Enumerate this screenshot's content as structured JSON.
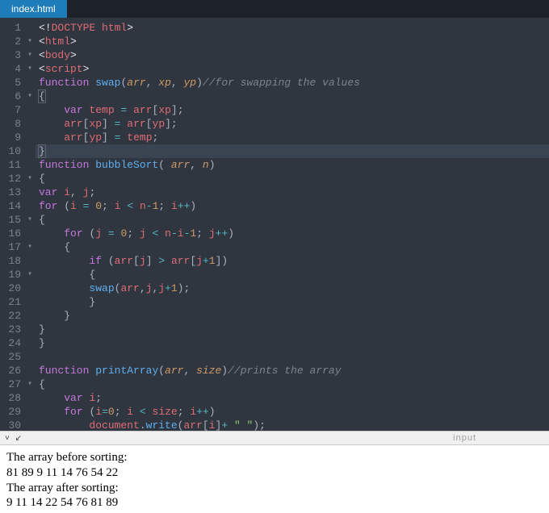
{
  "tab": {
    "label": "index.html"
  },
  "divider": {
    "left_icons": "˅   ↙",
    "right_label": "input"
  },
  "editor": {
    "lines": [
      {
        "n": 1,
        "fold": " ",
        "tokens": [
          [
            "tag-punc",
            "<!"
          ],
          [
            "tag-name",
            "DOCTYPE"
          ],
          [
            "plain",
            " "
          ],
          [
            "ident",
            "html"
          ],
          [
            "tag-punc",
            ">"
          ]
        ]
      },
      {
        "n": 2,
        "fold": "▾",
        "tokens": [
          [
            "tag-punc",
            "<"
          ],
          [
            "tag-name",
            "html"
          ],
          [
            "tag-punc",
            ">"
          ]
        ]
      },
      {
        "n": 3,
        "fold": "▾",
        "tokens": [
          [
            "tag-punc",
            "<"
          ],
          [
            "tag-name",
            "body"
          ],
          [
            "tag-punc",
            ">"
          ]
        ]
      },
      {
        "n": 4,
        "fold": "▾",
        "tokens": [
          [
            "tag-punc",
            "<"
          ],
          [
            "tag-name",
            "script"
          ],
          [
            "tag-punc",
            ">"
          ]
        ]
      },
      {
        "n": 5,
        "fold": " ",
        "tokens": [
          [
            "kw",
            "function"
          ],
          [
            "plain",
            " "
          ],
          [
            "fn",
            "swap"
          ],
          [
            "punc",
            "("
          ],
          [
            "param",
            "arr"
          ],
          [
            "punc",
            ", "
          ],
          [
            "param",
            "xp"
          ],
          [
            "punc",
            ", "
          ],
          [
            "param",
            "yp"
          ],
          [
            "punc",
            ")"
          ],
          [
            "cmt",
            "//for swapping the values"
          ]
        ]
      },
      {
        "n": 6,
        "fold": "▾",
        "tokens": [
          [
            "punc",
            "{",
            "brace-hl"
          ]
        ]
      },
      {
        "n": 7,
        "fold": " ",
        "tokens": [
          [
            "plain",
            "    "
          ],
          [
            "kw",
            "var"
          ],
          [
            "plain",
            " "
          ],
          [
            "ident",
            "temp"
          ],
          [
            "plain",
            " "
          ],
          [
            "op",
            "="
          ],
          [
            "plain",
            " "
          ],
          [
            "ident",
            "arr"
          ],
          [
            "punc",
            "["
          ],
          [
            "ident",
            "xp"
          ],
          [
            "punc",
            "];"
          ]
        ]
      },
      {
        "n": 8,
        "fold": " ",
        "tokens": [
          [
            "plain",
            "    "
          ],
          [
            "ident",
            "arr"
          ],
          [
            "punc",
            "["
          ],
          [
            "ident",
            "xp"
          ],
          [
            "punc",
            "]"
          ],
          [
            "plain",
            " "
          ],
          [
            "op",
            "="
          ],
          [
            "plain",
            " "
          ],
          [
            "ident",
            "arr"
          ],
          [
            "punc",
            "["
          ],
          [
            "ident",
            "yp"
          ],
          [
            "punc",
            "];"
          ]
        ]
      },
      {
        "n": 9,
        "fold": " ",
        "tokens": [
          [
            "plain",
            "    "
          ],
          [
            "ident",
            "arr"
          ],
          [
            "punc",
            "["
          ],
          [
            "ident",
            "yp"
          ],
          [
            "punc",
            "]"
          ],
          [
            "plain",
            " "
          ],
          [
            "op",
            "="
          ],
          [
            "plain",
            " "
          ],
          [
            "ident",
            "temp"
          ],
          [
            "punc",
            ";"
          ]
        ]
      },
      {
        "n": 10,
        "fold": " ",
        "highlight": true,
        "tokens": [
          [
            "punc",
            "}",
            "brace-hl"
          ]
        ]
      },
      {
        "n": 11,
        "fold": " ",
        "tokens": [
          [
            "kw",
            "function"
          ],
          [
            "plain",
            " "
          ],
          [
            "fn",
            "bubbleSort"
          ],
          [
            "punc",
            "( "
          ],
          [
            "param",
            "arr"
          ],
          [
            "punc",
            ", "
          ],
          [
            "param",
            "n"
          ],
          [
            "punc",
            ")"
          ]
        ]
      },
      {
        "n": 12,
        "fold": "▾",
        "tokens": [
          [
            "punc",
            "{"
          ]
        ]
      },
      {
        "n": 13,
        "fold": " ",
        "tokens": [
          [
            "kw",
            "var"
          ],
          [
            "plain",
            " "
          ],
          [
            "ident",
            "i"
          ],
          [
            "punc",
            ", "
          ],
          [
            "ident",
            "j"
          ],
          [
            "punc",
            ";"
          ]
        ]
      },
      {
        "n": 14,
        "fold": " ",
        "tokens": [
          [
            "kw",
            "for"
          ],
          [
            "plain",
            " "
          ],
          [
            "punc",
            "("
          ],
          [
            "ident",
            "i"
          ],
          [
            "plain",
            " "
          ],
          [
            "op",
            "="
          ],
          [
            "plain",
            " "
          ],
          [
            "num",
            "0"
          ],
          [
            "punc",
            "; "
          ],
          [
            "ident",
            "i"
          ],
          [
            "plain",
            " "
          ],
          [
            "op",
            "<"
          ],
          [
            "plain",
            " "
          ],
          [
            "ident",
            "n"
          ],
          [
            "op",
            "-"
          ],
          [
            "num",
            "1"
          ],
          [
            "punc",
            "; "
          ],
          [
            "ident",
            "i"
          ],
          [
            "op",
            "++"
          ],
          [
            "punc",
            ")"
          ]
        ]
      },
      {
        "n": 15,
        "fold": "▾",
        "tokens": [
          [
            "punc",
            "{"
          ]
        ]
      },
      {
        "n": 16,
        "fold": " ",
        "tokens": [
          [
            "plain",
            "    "
          ],
          [
            "kw",
            "for"
          ],
          [
            "plain",
            " "
          ],
          [
            "punc",
            "("
          ],
          [
            "ident",
            "j"
          ],
          [
            "plain",
            " "
          ],
          [
            "op",
            "="
          ],
          [
            "plain",
            " "
          ],
          [
            "num",
            "0"
          ],
          [
            "punc",
            "; "
          ],
          [
            "ident",
            "j"
          ],
          [
            "plain",
            " "
          ],
          [
            "op",
            "<"
          ],
          [
            "plain",
            " "
          ],
          [
            "ident",
            "n"
          ],
          [
            "op",
            "-"
          ],
          [
            "ident",
            "i"
          ],
          [
            "op",
            "-"
          ],
          [
            "num",
            "1"
          ],
          [
            "punc",
            "; "
          ],
          [
            "ident",
            "j"
          ],
          [
            "op",
            "++"
          ],
          [
            "punc",
            ")"
          ]
        ]
      },
      {
        "n": 17,
        "fold": "▾",
        "tokens": [
          [
            "plain",
            "    "
          ],
          [
            "punc",
            "{"
          ]
        ]
      },
      {
        "n": 18,
        "fold": " ",
        "tokens": [
          [
            "plain",
            "        "
          ],
          [
            "kw",
            "if"
          ],
          [
            "plain",
            " "
          ],
          [
            "punc",
            "("
          ],
          [
            "ident",
            "arr"
          ],
          [
            "punc",
            "["
          ],
          [
            "ident",
            "j"
          ],
          [
            "punc",
            "]"
          ],
          [
            "plain",
            " "
          ],
          [
            "op",
            ">"
          ],
          [
            "plain",
            " "
          ],
          [
            "ident",
            "arr"
          ],
          [
            "punc",
            "["
          ],
          [
            "ident",
            "j"
          ],
          [
            "op",
            "+"
          ],
          [
            "num",
            "1"
          ],
          [
            "punc",
            "])"
          ]
        ]
      },
      {
        "n": 19,
        "fold": "▾",
        "tokens": [
          [
            "plain",
            "        "
          ],
          [
            "punc",
            "{"
          ]
        ]
      },
      {
        "n": 20,
        "fold": " ",
        "tokens": [
          [
            "plain",
            "        "
          ],
          [
            "fn",
            "swap"
          ],
          [
            "punc",
            "("
          ],
          [
            "ident",
            "arr"
          ],
          [
            "punc",
            ","
          ],
          [
            "ident",
            "j"
          ],
          [
            "punc",
            ","
          ],
          [
            "ident",
            "j"
          ],
          [
            "op",
            "+"
          ],
          [
            "num",
            "1"
          ],
          [
            "punc",
            ");"
          ]
        ]
      },
      {
        "n": 21,
        "fold": " ",
        "tokens": [
          [
            "plain",
            "        "
          ],
          [
            "punc",
            "}"
          ]
        ]
      },
      {
        "n": 22,
        "fold": " ",
        "tokens": [
          [
            "plain",
            "    "
          ],
          [
            "punc",
            "}"
          ]
        ]
      },
      {
        "n": 23,
        "fold": " ",
        "tokens": [
          [
            "punc",
            "}"
          ]
        ]
      },
      {
        "n": 24,
        "fold": " ",
        "tokens": [
          [
            "punc",
            "}"
          ]
        ]
      },
      {
        "n": 25,
        "fold": " ",
        "tokens": [
          [
            "plain",
            " "
          ]
        ]
      },
      {
        "n": 26,
        "fold": " ",
        "tokens": [
          [
            "kw",
            "function"
          ],
          [
            "plain",
            " "
          ],
          [
            "fn",
            "printArray"
          ],
          [
            "punc",
            "("
          ],
          [
            "param",
            "arr"
          ],
          [
            "punc",
            ", "
          ],
          [
            "param",
            "size"
          ],
          [
            "punc",
            ")"
          ],
          [
            "cmt",
            "//prints the array"
          ]
        ]
      },
      {
        "n": 27,
        "fold": "▾",
        "tokens": [
          [
            "punc",
            "{"
          ]
        ]
      },
      {
        "n": 28,
        "fold": " ",
        "tokens": [
          [
            "plain",
            "    "
          ],
          [
            "kw",
            "var"
          ],
          [
            "plain",
            " "
          ],
          [
            "ident",
            "i"
          ],
          [
            "punc",
            ";"
          ]
        ]
      },
      {
        "n": 29,
        "fold": " ",
        "tokens": [
          [
            "plain",
            "    "
          ],
          [
            "kw",
            "for"
          ],
          [
            "plain",
            " "
          ],
          [
            "punc",
            "("
          ],
          [
            "ident",
            "i"
          ],
          [
            "op",
            "="
          ],
          [
            "num",
            "0"
          ],
          [
            "punc",
            "; "
          ],
          [
            "ident",
            "i"
          ],
          [
            "plain",
            " "
          ],
          [
            "op",
            "<"
          ],
          [
            "plain",
            " "
          ],
          [
            "ident",
            "size"
          ],
          [
            "punc",
            "; "
          ],
          [
            "ident",
            "i"
          ],
          [
            "op",
            "++"
          ],
          [
            "punc",
            ")"
          ]
        ]
      },
      {
        "n": 30,
        "fold": " ",
        "tokens": [
          [
            "plain",
            "        "
          ],
          [
            "ident",
            "document"
          ],
          [
            "punc",
            "."
          ],
          [
            "fn",
            "write"
          ],
          [
            "punc",
            "("
          ],
          [
            "ident",
            "arr"
          ],
          [
            "punc",
            "["
          ],
          [
            "ident",
            "i"
          ],
          [
            "punc",
            "]"
          ],
          [
            "op",
            "+"
          ],
          [
            "plain",
            " "
          ],
          [
            "str",
            "\" \""
          ],
          [
            "punc",
            ");"
          ]
        ]
      }
    ]
  },
  "output": {
    "lines": [
      "The array before sorting:",
      "81 89 9 11 14 76 54 22",
      "The array after sorting:",
      "9 11 14 22 54 76 81 89"
    ]
  }
}
